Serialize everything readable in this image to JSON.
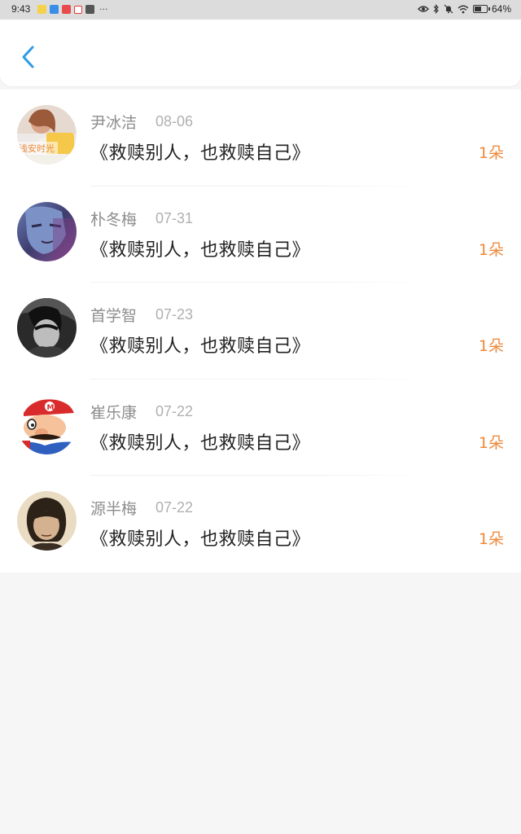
{
  "status_bar": {
    "time": "9:43",
    "more": "···",
    "battery": "64%",
    "battery_level": 0.64
  },
  "header": {
    "back_icon": "chevron-left-icon",
    "accent_color": "#2e9be6"
  },
  "items": [
    {
      "name": "尹冰洁",
      "date": "08-06",
      "title": "《救赎别人，也救赎自己》",
      "count": "1朵",
      "avatar_text": "浅安时光"
    },
    {
      "name": "朴冬梅",
      "date": "07-31",
      "title": "《救赎别人，也救赎自己》",
      "count": "1朵"
    },
    {
      "name": "首学智",
      "date": "07-23",
      "title": "《救赎别人，也救赎自己》",
      "count": "1朵"
    },
    {
      "name": "崔乐康",
      "date": "07-22",
      "title": "《救赎别人，也救赎自己》",
      "count": "1朵"
    },
    {
      "name": "源半梅",
      "date": "07-22",
      "title": "《救赎别人，也救赎自己》",
      "count": "1朵"
    }
  ],
  "colors": {
    "count": "#ef8a3c",
    "name": "#8d8d8d",
    "date": "#b0b0b0",
    "title": "#222222",
    "page_background": "#f7f6f6"
  }
}
